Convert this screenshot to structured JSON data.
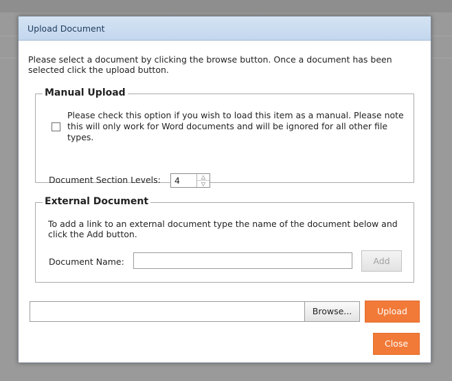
{
  "dialog": {
    "title": "Upload Document",
    "intro": "Please select a document by clicking the browse button. Once a document has been selected click the upload button."
  },
  "manual_upload": {
    "legend": "Manual Upload",
    "checkbox_text": "Please check this option if you wish to load this item as a manual. Please note this will only work for Word documents and will be ignored for all other file types.",
    "checked": false,
    "levels_label": "Document Section Levels:",
    "levels_value": "4",
    "up_icon": "chevron-up-icon",
    "down_icon": "chevron-down-icon"
  },
  "external_document": {
    "legend": "External Document",
    "description": "To add a link to an external document type the name of the document below and click the Add button.",
    "name_label": "Document Name:",
    "name_value": "",
    "add_label": "Add"
  },
  "file": {
    "value": "",
    "browse_label": "Browse..."
  },
  "actions": {
    "upload_label": "Upload",
    "close_label": "Close"
  },
  "colors": {
    "accent": "#f27a38",
    "titlebar": "#c9dcf0",
    "overlay": "#9a9a9a"
  }
}
